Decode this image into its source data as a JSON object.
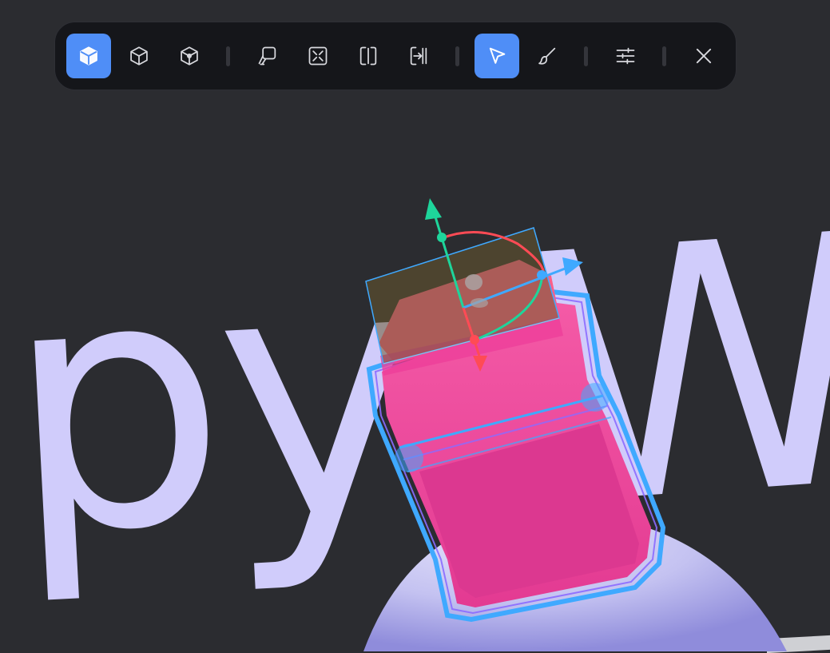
{
  "scene": {
    "text_left": "py",
    "text_right": "W"
  },
  "toolbar": {
    "tools": [
      {
        "id": "object-mode",
        "icon": "cube-solid-icon",
        "active": true
      },
      {
        "id": "edge-mode",
        "icon": "cube-wireframe-icon",
        "active": false
      },
      {
        "id": "vertex-mode",
        "icon": "cube-vertex-icon",
        "active": false
      },
      {
        "id": "lasso-select",
        "icon": "lasso-icon",
        "active": false
      },
      {
        "id": "fit-view",
        "icon": "frame-collapse-icon",
        "active": false
      },
      {
        "id": "split-view",
        "icon": "split-vertical-icon",
        "active": false
      },
      {
        "id": "align-to-edge",
        "icon": "arrow-to-bar-icon",
        "active": false
      },
      {
        "id": "select-tool",
        "icon": "pointer-arrow-icon",
        "active": true
      },
      {
        "id": "paint-tool",
        "icon": "brush-icon",
        "active": false
      },
      {
        "id": "settings",
        "icon": "sliders-icon",
        "active": false
      },
      {
        "id": "close",
        "icon": "close-icon",
        "active": false
      }
    ]
  },
  "colors": {
    "background": "#2b2c30",
    "toolbar_bg": "#15161a",
    "accent": "#4f8ef7",
    "scene_text": "#d0ccfb",
    "selected_object": "#e8388f",
    "selection_outline": "#3fa9ff",
    "gizmo_x": "#ff4b55",
    "gizmo_y": "#1ed59b",
    "gizmo_z": "#3fa9ff"
  }
}
